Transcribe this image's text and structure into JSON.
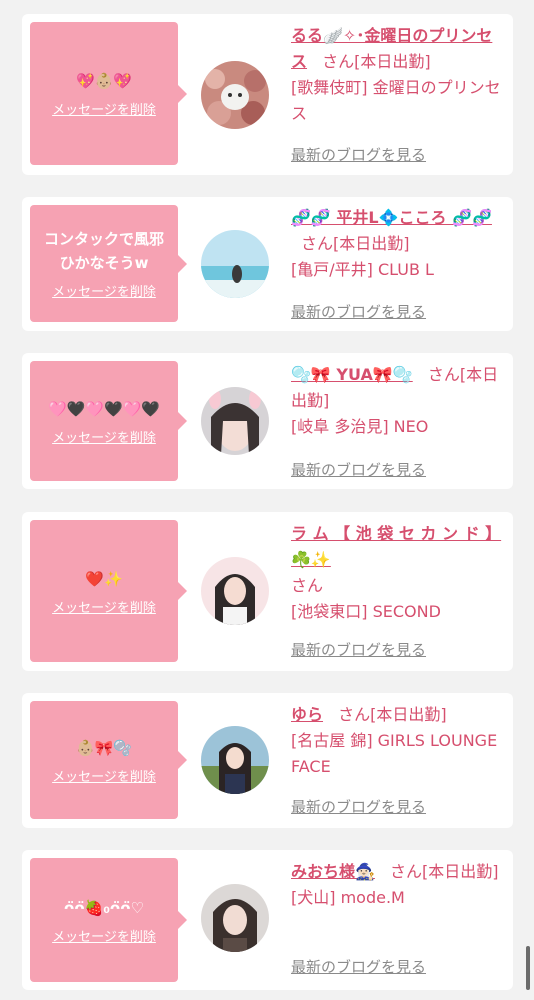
{
  "cards": [
    {
      "message": "💖👶🏼💖",
      "delete_label": "メッセージを削除",
      "name": "るる🪽✧･金曜日のプリンセス",
      "san": "さん",
      "status": "[本日出勤]",
      "shop": "[歌舞伎町] 金曜日のプリンセス",
      "blog_label": "最新のブログを見る"
    },
    {
      "message": "コンタックで風邪ひかなそうw",
      "delete_label": "メッセージを削除",
      "name": "🧬🧬 平井L💠こころ 🧬🧬",
      "san": "さん",
      "status": "[本日出勤]",
      "shop": "[亀戸/平井] CLUB L",
      "blog_label": "最新のブログを見る"
    },
    {
      "message": "🩷🖤🩷🖤🩷🖤",
      "delete_label": "メッセージを削除",
      "name": "🫧🎀 YUA🎀🫧",
      "san": "さん",
      "status": "[本日出勤]",
      "shop": "[岐阜 多治見] NEO",
      "blog_label": "最新のブログを見る"
    },
    {
      "message": "❤️✨",
      "delete_label": "メッセージを削除",
      "name": "ラ ム 【 池 袋 セ カ ン ド 】 ☘️✨",
      "san": "さん",
      "status": "",
      "shop": "[池袋東口] SECOND",
      "blog_label": "最新のブログを見る"
    },
    {
      "message": "👶🏼🎀🫧",
      "delete_label": "メッセージを削除",
      "name": "ゆら",
      "san": "さん",
      "status": "[本日出勤]",
      "shop": "[名古屋 錦] GIRLS LOUNGE FACE",
      "blog_label": "最新のブログを見る"
    },
    {
      "message": "ᴖ̈ᴖ̈🍓₀ᴖ̈ᴖ̈♡",
      "delete_label": "メッセージを削除",
      "name": "みおち様🧙🏻‍♀️",
      "san": "さん",
      "status": "[本日出勤]",
      "shop": "[犬山] mode.M",
      "blog_label": "最新のブログを見る"
    }
  ]
}
